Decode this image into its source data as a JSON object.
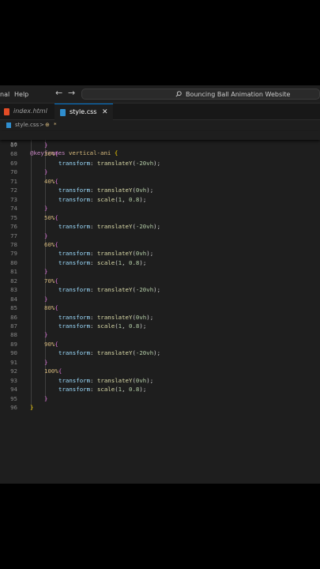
{
  "menu": [
    "nal",
    "Help"
  ],
  "command_center": {
    "label": "Bouncing Ball Animation Website"
  },
  "tabs": [
    {
      "label": "index.html",
      "icon": "html5-icon",
      "active": false
    },
    {
      "label": "style.css",
      "icon": "css3-icon",
      "active": true
    }
  ],
  "breadcrumb": {
    "file": "style.css",
    "separator": ">",
    "symbol": "*"
  },
  "sticky": {
    "line": "56",
    "at": "@keyframes",
    "name": "vertical-ani",
    "brace": "{"
  },
  "lines": [
    {
      "n": "67",
      "ind": 1,
      "t": [
        [
          "t-br2",
          "}"
        ]
      ]
    },
    {
      "n": "68",
      "ind": 1,
      "t": [
        [
          "t-sel",
          "30%"
        ],
        [
          "t-br2",
          "{"
        ]
      ]
    },
    {
      "n": "69",
      "ind": 2,
      "t": [
        [
          "t-prop",
          "transform"
        ],
        [
          "t-pun",
          ": "
        ],
        [
          "t-fn",
          "translateY"
        ],
        [
          "t-pun",
          "("
        ],
        [
          "t-num",
          "-20vh"
        ],
        [
          "t-pun",
          ");"
        ]
      ]
    },
    {
      "n": "70",
      "ind": 1,
      "t": [
        [
          "t-br2",
          "}"
        ]
      ]
    },
    {
      "n": "71",
      "ind": 1,
      "t": [
        [
          "t-sel",
          "40%"
        ],
        [
          "t-br2",
          "{"
        ]
      ]
    },
    {
      "n": "72",
      "ind": 2,
      "t": [
        [
          "t-prop",
          "transform"
        ],
        [
          "t-pun",
          ": "
        ],
        [
          "t-fn",
          "translateY"
        ],
        [
          "t-pun",
          "("
        ],
        [
          "t-num",
          "0vh"
        ],
        [
          "t-pun",
          ");"
        ]
      ]
    },
    {
      "n": "73",
      "ind": 2,
      "t": [
        [
          "t-prop",
          "transform"
        ],
        [
          "t-pun",
          ": "
        ],
        [
          "t-fn",
          "scale"
        ],
        [
          "t-pun",
          "("
        ],
        [
          "t-num",
          "1"
        ],
        [
          "t-pun",
          ", "
        ],
        [
          "t-num",
          "0.8"
        ],
        [
          "t-pun",
          ");"
        ]
      ]
    },
    {
      "n": "74",
      "ind": 1,
      "t": [
        [
          "t-br2",
          "}"
        ]
      ]
    },
    {
      "n": "75",
      "ind": 1,
      "t": [
        [
          "t-sel",
          "50%"
        ],
        [
          "t-br2",
          "{"
        ]
      ]
    },
    {
      "n": "76",
      "ind": 2,
      "t": [
        [
          "t-prop",
          "transform"
        ],
        [
          "t-pun",
          ": "
        ],
        [
          "t-fn",
          "translateY"
        ],
        [
          "t-pun",
          "("
        ],
        [
          "t-num",
          "-20vh"
        ],
        [
          "t-pun",
          ");"
        ]
      ]
    },
    {
      "n": "77",
      "ind": 1,
      "t": [
        [
          "t-br2",
          "}"
        ]
      ]
    },
    {
      "n": "78",
      "ind": 1,
      "t": [
        [
          "t-sel",
          "60%"
        ],
        [
          "t-br2",
          "{"
        ]
      ]
    },
    {
      "n": "79",
      "ind": 2,
      "t": [
        [
          "t-prop",
          "transform"
        ],
        [
          "t-pun",
          ": "
        ],
        [
          "t-fn",
          "translateY"
        ],
        [
          "t-pun",
          "("
        ],
        [
          "t-num",
          "0vh"
        ],
        [
          "t-pun",
          ");"
        ]
      ]
    },
    {
      "n": "80",
      "ind": 2,
      "t": [
        [
          "t-prop",
          "transform"
        ],
        [
          "t-pun",
          ": "
        ],
        [
          "t-fn",
          "scale"
        ],
        [
          "t-pun",
          "("
        ],
        [
          "t-num",
          "1"
        ],
        [
          "t-pun",
          ", "
        ],
        [
          "t-num",
          "0.8"
        ],
        [
          "t-pun",
          ");"
        ]
      ]
    },
    {
      "n": "81",
      "ind": 1,
      "t": [
        [
          "t-br2",
          "}"
        ]
      ]
    },
    {
      "n": "82",
      "ind": 1,
      "t": [
        [
          "t-sel",
          "70%"
        ],
        [
          "t-br2",
          "{"
        ]
      ]
    },
    {
      "n": "83",
      "ind": 2,
      "t": [
        [
          "t-prop",
          "transform"
        ],
        [
          "t-pun",
          ": "
        ],
        [
          "t-fn",
          "translateY"
        ],
        [
          "t-pun",
          "("
        ],
        [
          "t-num",
          "-20vh"
        ],
        [
          "t-pun",
          ");"
        ]
      ]
    },
    {
      "n": "84",
      "ind": 1,
      "t": [
        [
          "t-br2",
          "}"
        ]
      ]
    },
    {
      "n": "85",
      "ind": 1,
      "t": [
        [
          "t-sel",
          "80%"
        ],
        [
          "t-br2",
          "{"
        ]
      ]
    },
    {
      "n": "86",
      "ind": 2,
      "t": [
        [
          "t-prop",
          "transform"
        ],
        [
          "t-pun",
          ": "
        ],
        [
          "t-fn",
          "translateY"
        ],
        [
          "t-pun",
          "("
        ],
        [
          "t-num",
          "0vh"
        ],
        [
          "t-pun",
          ");"
        ]
      ]
    },
    {
      "n": "87",
      "ind": 2,
      "t": [
        [
          "t-prop",
          "transform"
        ],
        [
          "t-pun",
          ": "
        ],
        [
          "t-fn",
          "scale"
        ],
        [
          "t-pun",
          "("
        ],
        [
          "t-num",
          "1"
        ],
        [
          "t-pun",
          ", "
        ],
        [
          "t-num",
          "0.8"
        ],
        [
          "t-pun",
          ");"
        ]
      ]
    },
    {
      "n": "88",
      "ind": 1,
      "t": [
        [
          "t-br2",
          "}"
        ]
      ]
    },
    {
      "n": "89",
      "ind": 1,
      "t": [
        [
          "t-sel",
          "90%"
        ],
        [
          "t-br2",
          "{"
        ]
      ]
    },
    {
      "n": "90",
      "ind": 2,
      "t": [
        [
          "t-prop",
          "transform"
        ],
        [
          "t-pun",
          ": "
        ],
        [
          "t-fn",
          "translateY"
        ],
        [
          "t-pun",
          "("
        ],
        [
          "t-num",
          "-20vh"
        ],
        [
          "t-pun",
          ");"
        ]
      ]
    },
    {
      "n": "91",
      "ind": 1,
      "t": [
        [
          "t-br2",
          "}"
        ]
      ]
    },
    {
      "n": "92",
      "ind": 1,
      "t": [
        [
          "t-sel",
          "100%"
        ],
        [
          "t-br2",
          "{"
        ]
      ]
    },
    {
      "n": "93",
      "ind": 2,
      "t": [
        [
          "t-prop",
          "transform"
        ],
        [
          "t-pun",
          ": "
        ],
        [
          "t-fn",
          "translateY"
        ],
        [
          "t-pun",
          "("
        ],
        [
          "t-num",
          "0vh"
        ],
        [
          "t-pun",
          ");"
        ]
      ]
    },
    {
      "n": "94",
      "ind": 2,
      "t": [
        [
          "t-prop",
          "transform"
        ],
        [
          "t-pun",
          ": "
        ],
        [
          "t-fn",
          "scale"
        ],
        [
          "t-pun",
          "("
        ],
        [
          "t-num",
          "1"
        ],
        [
          "t-pun",
          ", "
        ],
        [
          "t-num",
          "0.8"
        ],
        [
          "t-pun",
          ");"
        ]
      ]
    },
    {
      "n": "95",
      "ind": 1,
      "t": [
        [
          "t-br2",
          "}"
        ]
      ]
    },
    {
      "n": "96",
      "ind": 0,
      "t": [
        [
          "t-br",
          "}"
        ]
      ]
    }
  ]
}
